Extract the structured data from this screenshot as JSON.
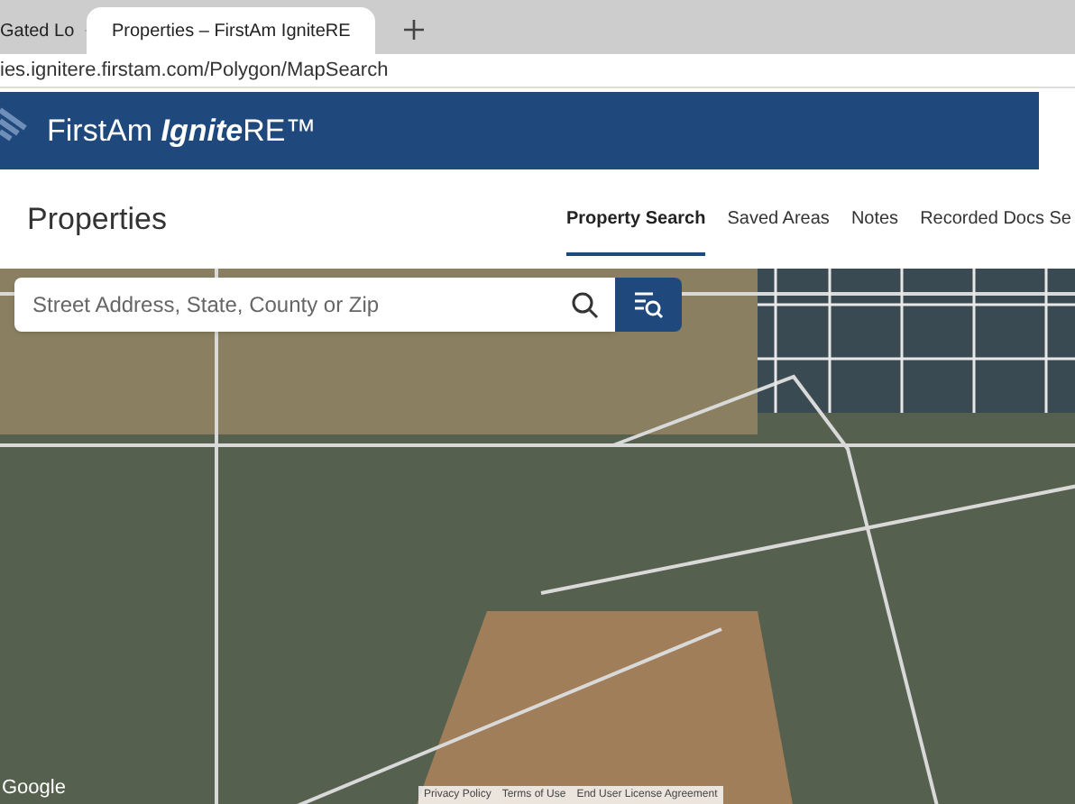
{
  "browser": {
    "tabs": [
      {
        "title": "Gated Lo",
        "selected": false
      },
      {
        "title": "Properties – FirstAm IgniteRE",
        "selected": true
      }
    ],
    "address": "ies.ignitere.firstam.com/Polygon/MapSearch"
  },
  "brand": {
    "name": "FirstAm ",
    "emphasis": "Ignite",
    "suffix": "RE™"
  },
  "page": {
    "title": "Properties",
    "tabs": [
      {
        "label": "Property Search",
        "selected": true
      },
      {
        "label": "Saved Areas",
        "selected": false
      },
      {
        "label": "Notes",
        "selected": false
      },
      {
        "label": "Recorded Docs Se",
        "selected": false
      }
    ]
  },
  "search": {
    "placeholder": "Street Address, State, County or Zip"
  },
  "map": {
    "attribution": "Google",
    "footer_links": [
      "Privacy Policy",
      "Terms of Use",
      "End User License Agreement"
    ]
  }
}
